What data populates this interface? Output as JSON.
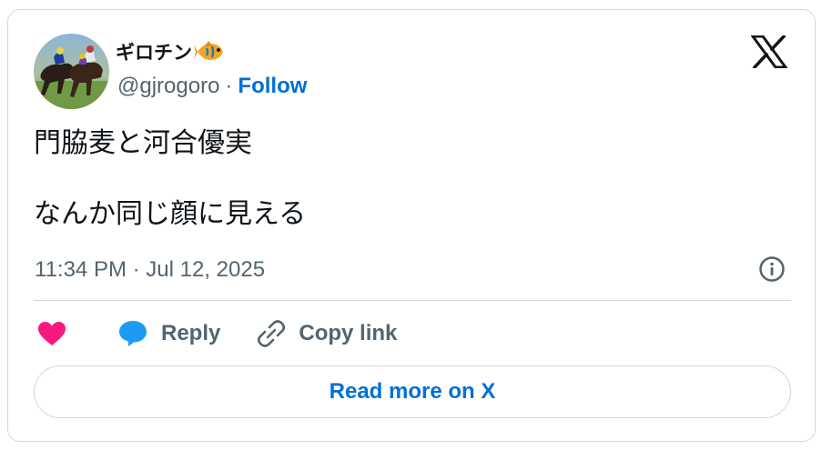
{
  "author": {
    "display_name": "ギロチン",
    "name_emoji": "fish-emoji",
    "handle": "@gjrogoro",
    "separator": "·",
    "follow_label": "Follow",
    "avatar": "horse-racing-avatar"
  },
  "tweet": {
    "lines": [
      "門脇麦と河合優実",
      "",
      "なんか同じ顔に見える"
    ],
    "timestamp": "11:34 PM · Jul 12, 2025"
  },
  "actions": {
    "like_icon": "heart-icon",
    "reply_label": "Reply",
    "reply_icon": "speech-bubble-icon",
    "copy_label": "Copy link",
    "copy_icon": "link-icon"
  },
  "footer": {
    "read_more_label": "Read more on X"
  },
  "icons": {
    "x_logo": "x-logo-icon",
    "info": "info-icon"
  },
  "colors": {
    "follow_link": "#006fd6",
    "secondary_text": "#536471",
    "border": "#cfd9de",
    "heart": "#f91880",
    "reply_bubble": "#1d9bf0",
    "primary_text": "#0f1419"
  }
}
